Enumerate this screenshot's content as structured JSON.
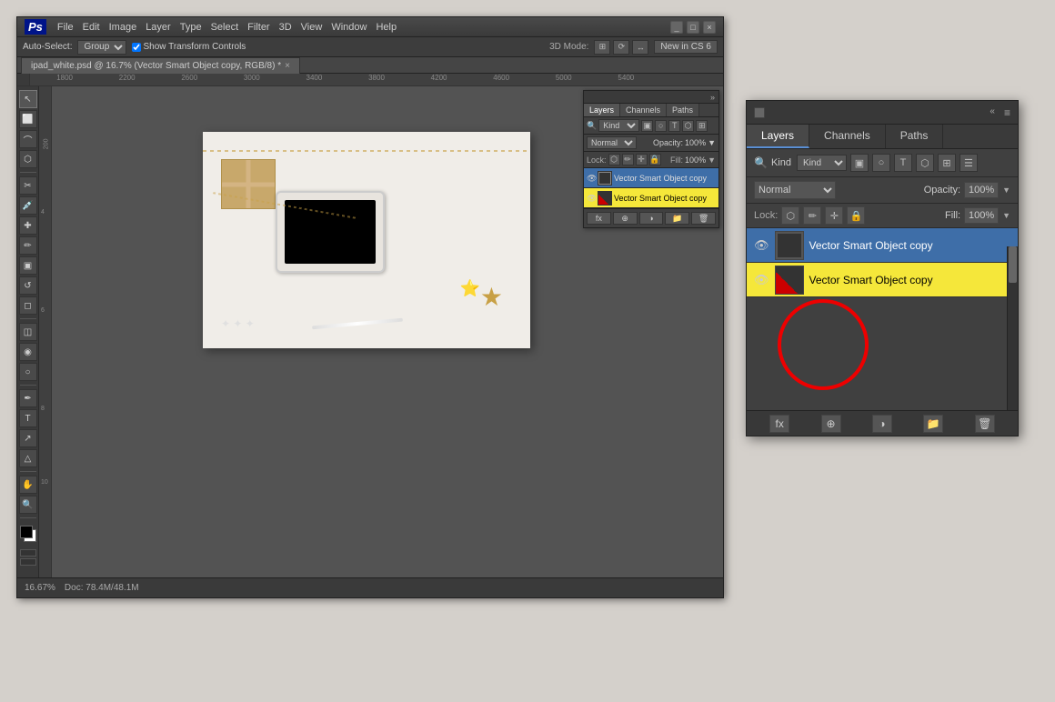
{
  "app": {
    "name": "Adobe Photoshop CS6",
    "logo": "Ps",
    "title": "ipad_white.psd @ 16.7% (Vector Smart Object copy, RGB/8) *"
  },
  "menu": {
    "items": [
      "File",
      "Edit",
      "Image",
      "Layer",
      "Type",
      "Select",
      "Filter",
      "3D",
      "View",
      "Window",
      "Help"
    ]
  },
  "toolbar": {
    "auto_select": "Auto-Select:",
    "auto_select_type": "Group",
    "show_transform": "Show Transform Controls",
    "mode_3d": "3D Mode:",
    "new_in": "New in CS 6"
  },
  "tab": {
    "name": "ipad_white.psd @ 16.7% (Vector Smart Object copy, RGB/8) *"
  },
  "layers_panel_small": {
    "title": "",
    "tabs": [
      "Layers",
      "Channels",
      "Paths"
    ],
    "blend_mode": "Normal",
    "opacity": "100%",
    "opacity_label": "Opacity:",
    "lock_label": "Lock:",
    "fill_label": "Fill:",
    "fill_val": "100%",
    "layers": [
      {
        "name": "Vector Smart Object copy",
        "active": true
      },
      {
        "name": "Vector Smart Object copy",
        "highlighted": true
      }
    ]
  },
  "layers_panel_large": {
    "collapse_btn": "«",
    "menu_btn": "≡",
    "tabs": [
      "Layers",
      "Channels",
      "Paths"
    ],
    "active_tab": "Layers",
    "kind_label": "Kind",
    "blend_mode": "Normal",
    "opacity_label": "Opacity:",
    "opacity_val": "100%",
    "lock_label": "Lock:",
    "fill_label": "Fill:",
    "fill_val": "100%",
    "layers": [
      {
        "name": "Vector Smart Object copy",
        "active": true
      },
      {
        "name": "Vector Smart Object copy",
        "highlighted": true
      }
    ],
    "footer_buttons": [
      "fx",
      "⊕",
      "☰",
      "📁",
      "🗑"
    ]
  },
  "statusbar": {
    "zoom": "16.67%",
    "doc_size": "Doc: 78.4M/48.1M"
  },
  "tools": {
    "items": [
      "↖",
      "⬡",
      "✂",
      "✏",
      "🖊",
      "⬜",
      "⬡",
      "T",
      "↗",
      "🔍",
      "⬛",
      "⬛"
    ]
  }
}
